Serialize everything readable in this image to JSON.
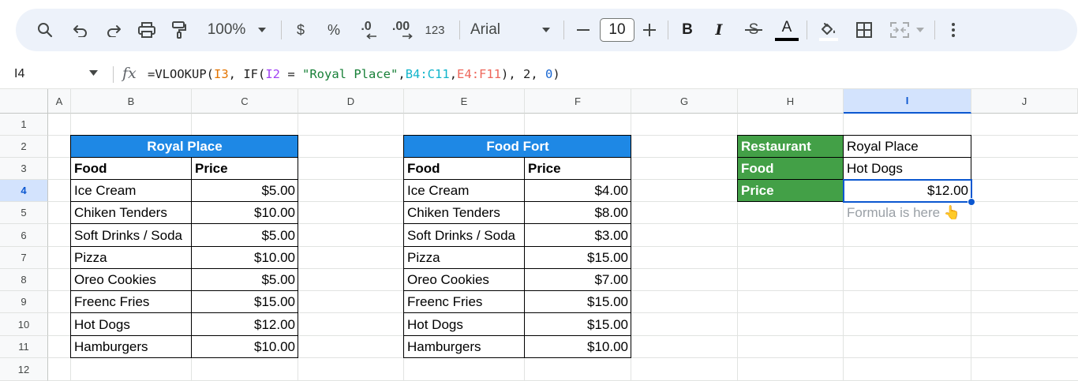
{
  "toolbar": {
    "zoom": "100%",
    "currency": "$",
    "percent": "%",
    "decrease_decimal": ".0",
    "increase_decimal": ".00",
    "number_format": "123",
    "font": "Arial",
    "font_size": "10",
    "bold": "B",
    "italic": "I",
    "strike": "S",
    "text_color": "A"
  },
  "formula_bar": {
    "cell_ref": "I4",
    "fx": "fx",
    "parts": [
      "=VLOOKUP(",
      "I3",
      ", IF(",
      "I2",
      " = ",
      "\"Royal Place\"",
      ",",
      "B4:C11",
      ",",
      "E4:F11",
      "), 2, ",
      "0",
      ")"
    ]
  },
  "columns": [
    "A",
    "B",
    "C",
    "D",
    "E",
    "F",
    "G",
    "H",
    "I",
    "J"
  ],
  "rows": [
    "1",
    "2",
    "3",
    "4",
    "5",
    "6",
    "7",
    "8",
    "9",
    "10",
    "11",
    "12"
  ],
  "selected": {
    "column": "I",
    "row": "4"
  },
  "royal_place": {
    "title": "Royal Place",
    "headers": [
      "Food",
      "Price"
    ],
    "rows": [
      [
        "Ice Cream",
        "$5.00"
      ],
      [
        "Chiken Tenders",
        "$10.00"
      ],
      [
        "Soft Drinks / Soda",
        "$5.00"
      ],
      [
        "Pizza",
        "$10.00"
      ],
      [
        "Oreo Cookies",
        "$5.00"
      ],
      [
        "Freenc Fries",
        "$15.00"
      ],
      [
        "Hot Dogs",
        "$12.00"
      ],
      [
        "Hamburgers",
        "$10.00"
      ]
    ]
  },
  "food_fort": {
    "title": "Food Fort",
    "headers": [
      "Food",
      "Price"
    ],
    "rows": [
      [
        "Ice Cream",
        "$4.00"
      ],
      [
        "Chiken Tenders",
        "$8.00"
      ],
      [
        "Soft Drinks / Soda",
        "$3.00"
      ],
      [
        "Pizza",
        "$15.00"
      ],
      [
        "Oreo Cookies",
        "$7.00"
      ],
      [
        "Freenc Fries",
        "$15.00"
      ],
      [
        "Hot Dogs",
        "$15.00"
      ],
      [
        "Hamburgers",
        "$10.00"
      ]
    ]
  },
  "lookup": {
    "rows": [
      [
        "Restaurant",
        "Royal Place"
      ],
      [
        "Food",
        "Hot Dogs"
      ],
      [
        "Price",
        "$12.00"
      ]
    ],
    "note": "Formula is here 👆"
  },
  "colors": {
    "header_blue": "#1e88e5",
    "label_green": "#43a047",
    "selection": "#0b57d0",
    "toolbar_bg": "#edf2fa"
  }
}
